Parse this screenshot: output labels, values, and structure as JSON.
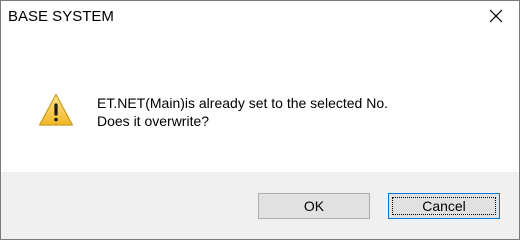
{
  "window": {
    "title": "BASE SYSTEM",
    "close_icon": "close-icon"
  },
  "message": {
    "icon": "warning-icon",
    "line1": "ET.NET(Main)is already set to the selected No.",
    "line2": "Does it overwrite?"
  },
  "buttons": {
    "ok_label": "OK",
    "cancel_label": "Cancel",
    "focused": "Cancel"
  },
  "colors": {
    "footer_bg": "#f0f0f0",
    "button_bg": "#e1e1e1",
    "focus_border": "#0078d7",
    "warning_fill": "#f6c342"
  }
}
